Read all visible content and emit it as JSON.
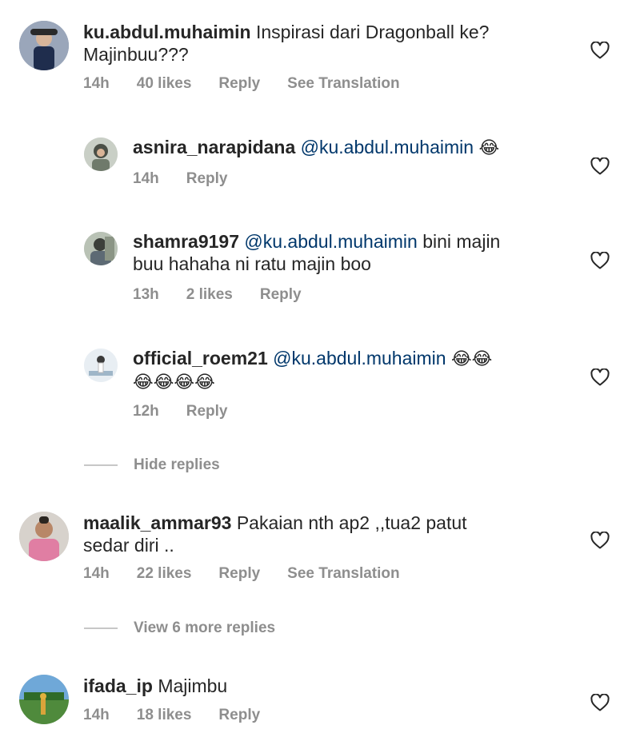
{
  "comments": [
    {
      "username": "ku.abdul.muhaimin",
      "text_line1": "Inspirasi dari Dragonball ke?",
      "text_line2": "Majinbuu???",
      "time": "14h",
      "likes": "40 likes",
      "reply": "Reply",
      "translate": "See Translation"
    },
    {
      "username": "maalik_ammar93",
      "text_line1": "Pakaian nth ap2 ,,tua2 patut",
      "text_line2": "sedar diri ..",
      "time": "14h",
      "likes": "22 likes",
      "reply": "Reply",
      "translate": "See Translation"
    },
    {
      "username": "ifada_ip",
      "text_line1": "Majimbu",
      "time": "14h",
      "likes": "18 likes",
      "reply": "Reply"
    }
  ],
  "replies": [
    {
      "username": "asnira_narapidana",
      "mention": "@ku.abdul.muhaimin",
      "emoji": "😂",
      "time": "14h",
      "reply": "Reply"
    },
    {
      "username": "shamra9197",
      "mention": "@ku.abdul.muhaimin",
      "text_line1": "bini majin",
      "text_line2": "buu hahaha ni ratu majin boo",
      "time": "13h",
      "likes": "2 likes",
      "reply": "Reply"
    },
    {
      "username": "official_roem21",
      "mention": "@ku.abdul.muhaimin",
      "emoji_line1": "😂😂",
      "emoji_line2": "😂😂😂😂",
      "time": "12h",
      "reply": "Reply"
    }
  ],
  "hide_replies": "Hide replies",
  "view_more_replies": "View 6 more replies",
  "icons": {
    "like": "heart-outline-icon",
    "avatar": "avatar"
  },
  "colors": {
    "text": "#262626",
    "meta": "#8e8e8e",
    "mention": "#00376b"
  }
}
